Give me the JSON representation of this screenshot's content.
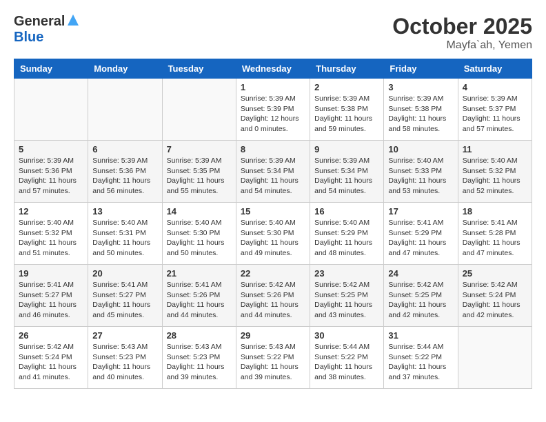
{
  "header": {
    "logo_general": "General",
    "logo_blue": "Blue",
    "month_title": "October 2025",
    "subtitle": "Mayfa`ah, Yemen"
  },
  "days_of_week": [
    "Sunday",
    "Monday",
    "Tuesday",
    "Wednesday",
    "Thursday",
    "Friday",
    "Saturday"
  ],
  "weeks": [
    [
      {
        "day": "",
        "info": ""
      },
      {
        "day": "",
        "info": ""
      },
      {
        "day": "",
        "info": ""
      },
      {
        "day": "1",
        "info": "Sunrise: 5:39 AM\nSunset: 5:39 PM\nDaylight: 12 hours\nand 0 minutes."
      },
      {
        "day": "2",
        "info": "Sunrise: 5:39 AM\nSunset: 5:38 PM\nDaylight: 11 hours\nand 59 minutes."
      },
      {
        "day": "3",
        "info": "Sunrise: 5:39 AM\nSunset: 5:38 PM\nDaylight: 11 hours\nand 58 minutes."
      },
      {
        "day": "4",
        "info": "Sunrise: 5:39 AM\nSunset: 5:37 PM\nDaylight: 11 hours\nand 57 minutes."
      }
    ],
    [
      {
        "day": "5",
        "info": "Sunrise: 5:39 AM\nSunset: 5:36 PM\nDaylight: 11 hours\nand 57 minutes."
      },
      {
        "day": "6",
        "info": "Sunrise: 5:39 AM\nSunset: 5:36 PM\nDaylight: 11 hours\nand 56 minutes."
      },
      {
        "day": "7",
        "info": "Sunrise: 5:39 AM\nSunset: 5:35 PM\nDaylight: 11 hours\nand 55 minutes."
      },
      {
        "day": "8",
        "info": "Sunrise: 5:39 AM\nSunset: 5:34 PM\nDaylight: 11 hours\nand 54 minutes."
      },
      {
        "day": "9",
        "info": "Sunrise: 5:39 AM\nSunset: 5:34 PM\nDaylight: 11 hours\nand 54 minutes."
      },
      {
        "day": "10",
        "info": "Sunrise: 5:40 AM\nSunset: 5:33 PM\nDaylight: 11 hours\nand 53 minutes."
      },
      {
        "day": "11",
        "info": "Sunrise: 5:40 AM\nSunset: 5:32 PM\nDaylight: 11 hours\nand 52 minutes."
      }
    ],
    [
      {
        "day": "12",
        "info": "Sunrise: 5:40 AM\nSunset: 5:32 PM\nDaylight: 11 hours\nand 51 minutes."
      },
      {
        "day": "13",
        "info": "Sunrise: 5:40 AM\nSunset: 5:31 PM\nDaylight: 11 hours\nand 50 minutes."
      },
      {
        "day": "14",
        "info": "Sunrise: 5:40 AM\nSunset: 5:30 PM\nDaylight: 11 hours\nand 50 minutes."
      },
      {
        "day": "15",
        "info": "Sunrise: 5:40 AM\nSunset: 5:30 PM\nDaylight: 11 hours\nand 49 minutes."
      },
      {
        "day": "16",
        "info": "Sunrise: 5:40 AM\nSunset: 5:29 PM\nDaylight: 11 hours\nand 48 minutes."
      },
      {
        "day": "17",
        "info": "Sunrise: 5:41 AM\nSunset: 5:29 PM\nDaylight: 11 hours\nand 47 minutes."
      },
      {
        "day": "18",
        "info": "Sunrise: 5:41 AM\nSunset: 5:28 PM\nDaylight: 11 hours\nand 47 minutes."
      }
    ],
    [
      {
        "day": "19",
        "info": "Sunrise: 5:41 AM\nSunset: 5:27 PM\nDaylight: 11 hours\nand 46 minutes."
      },
      {
        "day": "20",
        "info": "Sunrise: 5:41 AM\nSunset: 5:27 PM\nDaylight: 11 hours\nand 45 minutes."
      },
      {
        "day": "21",
        "info": "Sunrise: 5:41 AM\nSunset: 5:26 PM\nDaylight: 11 hours\nand 44 minutes."
      },
      {
        "day": "22",
        "info": "Sunrise: 5:42 AM\nSunset: 5:26 PM\nDaylight: 11 hours\nand 44 minutes."
      },
      {
        "day": "23",
        "info": "Sunrise: 5:42 AM\nSunset: 5:25 PM\nDaylight: 11 hours\nand 43 minutes."
      },
      {
        "day": "24",
        "info": "Sunrise: 5:42 AM\nSunset: 5:25 PM\nDaylight: 11 hours\nand 42 minutes."
      },
      {
        "day": "25",
        "info": "Sunrise: 5:42 AM\nSunset: 5:24 PM\nDaylight: 11 hours\nand 42 minutes."
      }
    ],
    [
      {
        "day": "26",
        "info": "Sunrise: 5:42 AM\nSunset: 5:24 PM\nDaylight: 11 hours\nand 41 minutes."
      },
      {
        "day": "27",
        "info": "Sunrise: 5:43 AM\nSunset: 5:23 PM\nDaylight: 11 hours\nand 40 minutes."
      },
      {
        "day": "28",
        "info": "Sunrise: 5:43 AM\nSunset: 5:23 PM\nDaylight: 11 hours\nand 39 minutes."
      },
      {
        "day": "29",
        "info": "Sunrise: 5:43 AM\nSunset: 5:22 PM\nDaylight: 11 hours\nand 39 minutes."
      },
      {
        "day": "30",
        "info": "Sunrise: 5:44 AM\nSunset: 5:22 PM\nDaylight: 11 hours\nand 38 minutes."
      },
      {
        "day": "31",
        "info": "Sunrise: 5:44 AM\nSunset: 5:22 PM\nDaylight: 11 hours\nand 37 minutes."
      },
      {
        "day": "",
        "info": ""
      }
    ]
  ]
}
